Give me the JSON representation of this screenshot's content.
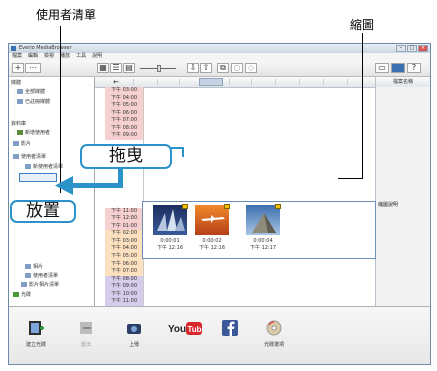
{
  "annotations": {
    "file_list": "使用者清單",
    "thumbnails": "縮圖",
    "drag": "拖曳",
    "drop": "放置"
  },
  "window": {
    "title": "Everio MediaBrowser",
    "menu": [
      "檔案",
      "編輯",
      "檢視",
      "播放",
      "工具",
      "說明"
    ]
  },
  "sidebar": {
    "sections": [
      {
        "label": "媒體",
        "items": [
          "全部媒體",
          "已註冊媒體"
        ]
      },
      {
        "label": "資料庫",
        "items": [
          "新增使用者",
          "影片",
          "使用者清單",
          "新使用者清單",
          "相片",
          "使用者清單",
          "影片相片清單",
          "光碟"
        ]
      }
    ]
  },
  "main": {
    "back": "←",
    "right_header": "檔案名稱",
    "right_info": "縮圖說明",
    "times": [
      "下午 03:00",
      "下午 04:00",
      "下午 05:00",
      "下午 06:00",
      "下午 07:00",
      "下午 08:00",
      "下午 09:00",
      "",
      "",
      "",
      "",
      "",
      "",
      "",
      "",
      "",
      "下午 11:00",
      "下午 12:00",
      "下午 01:00",
      "下午 02:00",
      "下午 03:00",
      "下午 04:00",
      "下午 05:00",
      "下午 06:00",
      "下午 07:00",
      "下午 08:00",
      "下午 09:00",
      "下午 10:00",
      "下午 11:00"
    ],
    "thumbnails": [
      {
        "name": "0:00:01",
        "time": "下午 12:16"
      },
      {
        "name": "0:00:02",
        "time": "下午 12:16"
      },
      {
        "name": "0:00:04",
        "time": "下午 12:17"
      }
    ]
  },
  "bottom": {
    "buttons": [
      {
        "label": "建立光碟"
      },
      {
        "label": "匯出"
      },
      {
        "label": "上傳"
      },
      {
        "label": "YouTube"
      },
      {
        "label": "Facebook"
      },
      {
        "label": "光碟選項"
      }
    ]
  },
  "colors": {
    "accent": "#2b93c9",
    "time_pink": "#f6cfd0",
    "time_purple": "#d8ccec",
    "time_orange": "#fde0bf"
  }
}
